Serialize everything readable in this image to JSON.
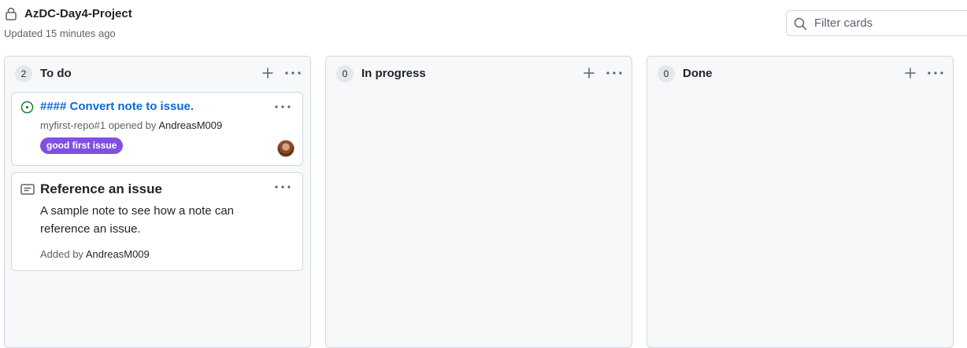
{
  "project": {
    "title": "AzDC-Day4-Project",
    "updated": "Updated 15 minutes ago"
  },
  "filter": {
    "placeholder": "Filter cards"
  },
  "columns": [
    {
      "count": "2",
      "title": "To do",
      "cards": [
        {
          "type": "issue",
          "title": "#### Convert note to issue.",
          "ref": "myfirst-repo#1 opened by ",
          "author": "AndreasM009",
          "label": "good first issue",
          "icon": "issue-open-icon"
        },
        {
          "type": "note",
          "title": "Reference an issue",
          "body": "A sample note to see how a note can reference an issue.",
          "added_prefix": "Added by ",
          "author": "AndreasM009",
          "icon": "note-icon"
        }
      ]
    },
    {
      "count": "0",
      "title": "In progress",
      "cards": []
    },
    {
      "count": "0",
      "title": "Done",
      "cards": []
    }
  ],
  "colors": {
    "link": "#0969da",
    "label": "#8250df",
    "issue_open": "#1a7f37",
    "column_bg": "#f6f8fa",
    "border": "#d1d9e0"
  },
  "icons": {
    "lock": "lock-icon",
    "search": "search-icon",
    "add": "plus-icon",
    "more": "kebab-horizontal-icon"
  }
}
